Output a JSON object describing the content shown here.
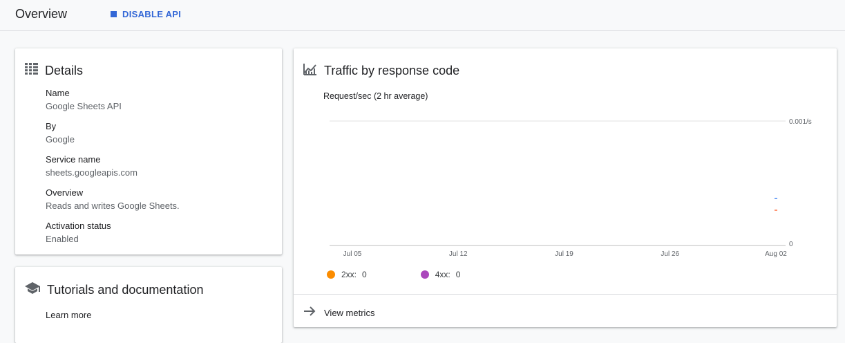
{
  "header": {
    "title": "Overview",
    "disable_label": "DISABLE API"
  },
  "details": {
    "title": "Details",
    "fields": [
      {
        "label": "Name",
        "value": "Google Sheets API"
      },
      {
        "label": "By",
        "value": "Google"
      },
      {
        "label": "Service name",
        "value": "sheets.googleapis.com"
      },
      {
        "label": "Overview",
        "value": "Reads and writes Google Sheets."
      },
      {
        "label": "Activation status",
        "value": "Enabled"
      }
    ]
  },
  "tutorials": {
    "title": "Tutorials and documentation",
    "learn_more": "Learn more"
  },
  "traffic": {
    "title": "Traffic by response code",
    "subtitle": "Request/sec (2 hr average)",
    "view_metrics": "View metrics",
    "legend": [
      {
        "name": "2xx:",
        "value": "0",
        "color": "#fb8c00"
      },
      {
        "name": "4xx:",
        "value": "0",
        "color": "#ab47bc"
      }
    ]
  },
  "colors": {
    "accent": "#3367d6",
    "series_2xx": "#fb8c00",
    "series_4xx": "#ab47bc"
  },
  "chart_data": {
    "type": "line",
    "title": "Traffic by response code",
    "subtitle": "Request/sec (2 hr average)",
    "x_ticks": [
      "Jul 05",
      "Jul 12",
      "Jul 19",
      "Jul 26",
      "Aug 02"
    ],
    "y_ticks": [
      "0",
      "0.001/s"
    ],
    "ylim": [
      0,
      0.001
    ],
    "grid": true,
    "series": [
      {
        "name": "2xx",
        "values": [
          0
        ],
        "color": "#fb8c00"
      },
      {
        "name": "4xx",
        "values": [
          0
        ],
        "color": "#ab47bc"
      }
    ]
  }
}
